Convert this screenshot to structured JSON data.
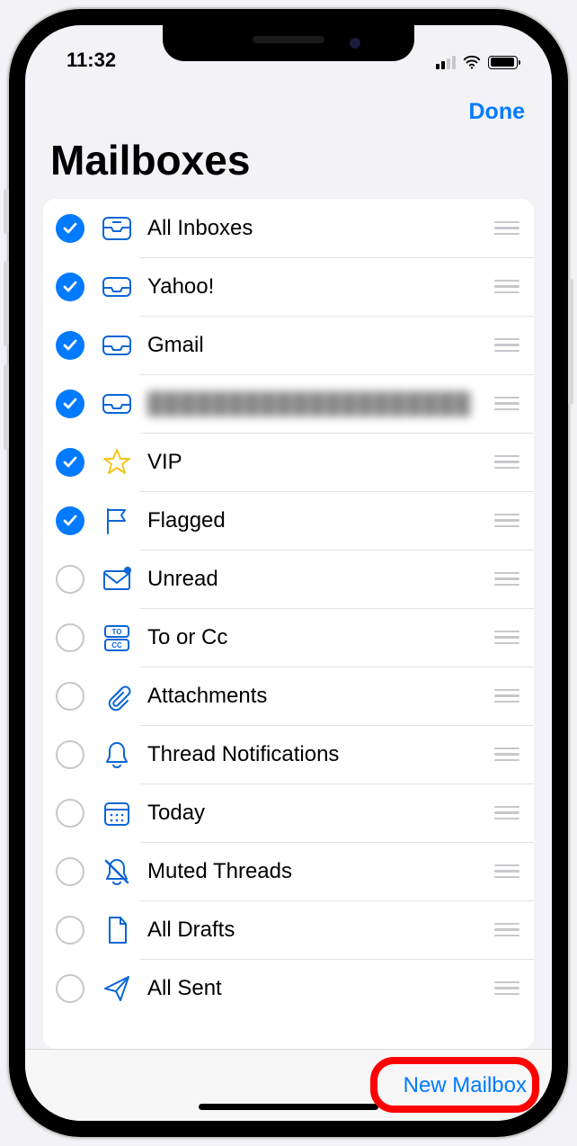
{
  "status": {
    "time": "11:32"
  },
  "nav": {
    "done": "Done"
  },
  "title": "Mailboxes",
  "mailboxes": [
    {
      "label": "All Inboxes",
      "checked": true,
      "icon": "all-inboxes"
    },
    {
      "label": "Yahoo!",
      "checked": true,
      "icon": "inbox"
    },
    {
      "label": "Gmail",
      "checked": true,
      "icon": "inbox"
    },
    {
      "label": "████████████████████",
      "checked": true,
      "icon": "inbox",
      "blurred": true
    },
    {
      "label": "VIP",
      "checked": true,
      "icon": "star"
    },
    {
      "label": "Flagged",
      "checked": true,
      "icon": "flag"
    },
    {
      "label": "Unread",
      "checked": false,
      "icon": "unread"
    },
    {
      "label": "To or Cc",
      "checked": false,
      "icon": "tocc"
    },
    {
      "label": "Attachments",
      "checked": false,
      "icon": "paperclip"
    },
    {
      "label": "Thread Notifications",
      "checked": false,
      "icon": "bell"
    },
    {
      "label": "Today",
      "checked": false,
      "icon": "calendar"
    },
    {
      "label": "Muted Threads",
      "checked": false,
      "icon": "bell-slash"
    },
    {
      "label": "All Drafts",
      "checked": false,
      "icon": "draft"
    },
    {
      "label": "All Sent",
      "checked": false,
      "icon": "send"
    }
  ],
  "toolbar": {
    "new_mailbox": "New Mailbox"
  },
  "colors": {
    "accent": "#007aff",
    "highlight": "#ff0000"
  }
}
